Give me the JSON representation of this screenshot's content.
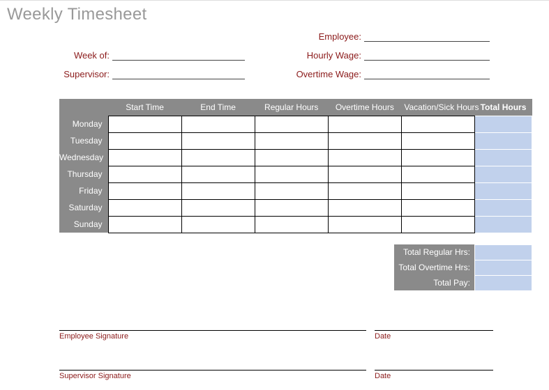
{
  "title": "Weekly Timesheet",
  "fields": {
    "employee_label": "Employee:",
    "week_of_label": "Week of:",
    "hourly_wage_label": "Hourly Wage:",
    "supervisor_label": "Supervisor:",
    "overtime_wage_label": "Overtime Wage:"
  },
  "table": {
    "columns": {
      "start_time": "Start Time",
      "end_time": "End Time",
      "regular_hours": "Regular Hours",
      "overtime_hours": "Overtime Hours",
      "vacation_sick": "Vacation/Sick Hours",
      "total_hours": "Total Hours"
    },
    "days": [
      "Monday",
      "Tuesday",
      "Wednesday",
      "Thursday",
      "Friday",
      "Saturday",
      "Sunday"
    ],
    "cells": {
      "Monday": {
        "start": "",
        "end": "",
        "reg": "",
        "ot": "",
        "vac": "",
        "total": ""
      },
      "Tuesday": {
        "start": "",
        "end": "",
        "reg": "",
        "ot": "",
        "vac": "",
        "total": ""
      },
      "Wednesday": {
        "start": "",
        "end": "",
        "reg": "",
        "ot": "",
        "vac": "",
        "total": ""
      },
      "Thursday": {
        "start": "",
        "end": "",
        "reg": "",
        "ot": "",
        "vac": "",
        "total": ""
      },
      "Friday": {
        "start": "",
        "end": "",
        "reg": "",
        "ot": "",
        "vac": "",
        "total": ""
      },
      "Saturday": {
        "start": "",
        "end": "",
        "reg": "",
        "ot": "",
        "vac": "",
        "total": ""
      },
      "Sunday": {
        "start": "",
        "end": "",
        "reg": "",
        "ot": "",
        "vac": "",
        "total": ""
      }
    }
  },
  "summary": {
    "total_regular_label": "Total Regular Hrs:",
    "total_overtime_label": "Total Overtime Hrs:",
    "total_pay_label": "Total Pay:",
    "total_regular_value": "",
    "total_overtime_value": "",
    "total_pay_value": ""
  },
  "signatures": {
    "employee_label": "Employee Signature",
    "supervisor_label": "Supervisor Signature",
    "date_label": "Date"
  }
}
